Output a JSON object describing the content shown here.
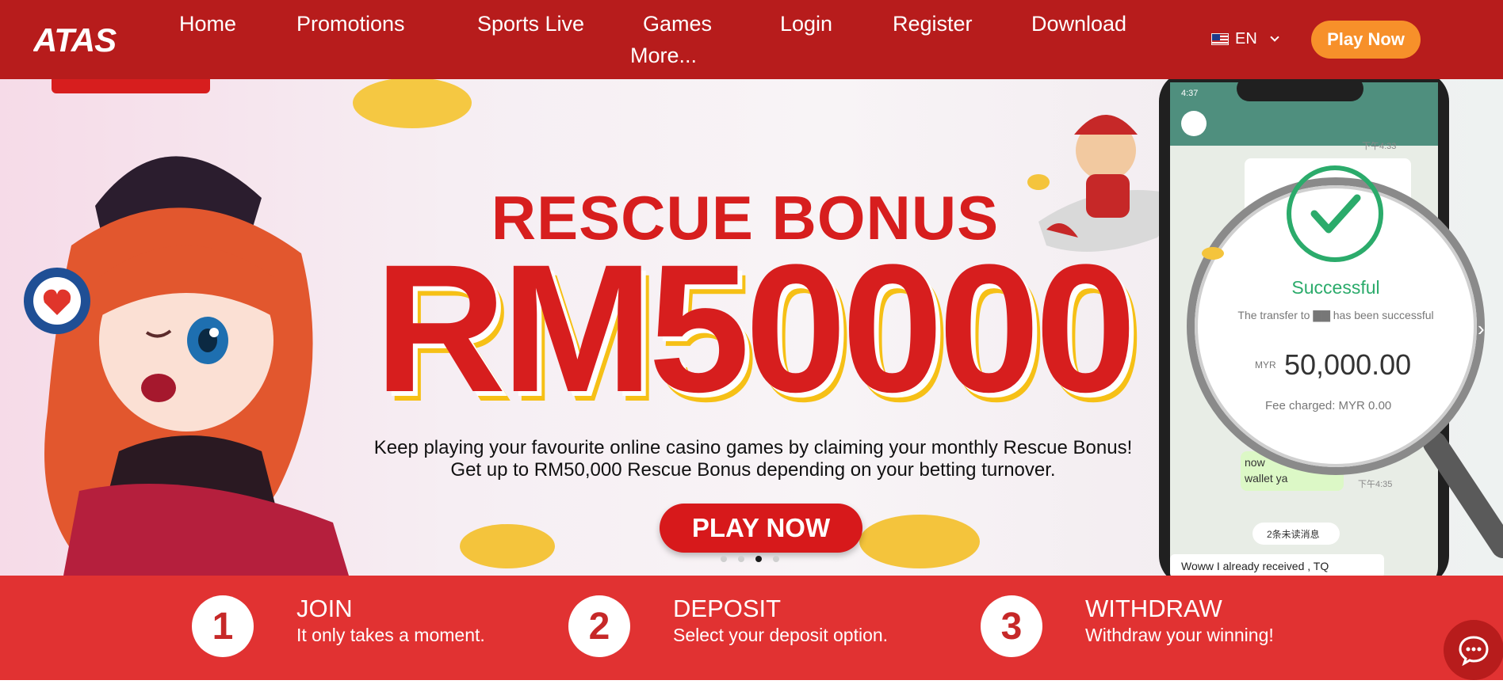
{
  "brand": {
    "logo_text": "ATAS"
  },
  "nav": {
    "items": [
      "Home",
      "Promotions",
      "Sports Live",
      "Games",
      "Login",
      "Register",
      "Download",
      "More..."
    ],
    "language": "EN",
    "play_now": "Play Now"
  },
  "hero": {
    "title": "RESCUE BONUS",
    "amount": "RM50000",
    "line1": "Keep playing your favourite online casino games by claiming your monthly Rescue Bonus!",
    "line2": "Get up to RM50,000 Rescue Bonus depending on your betting turnover.",
    "button": "PLAY NOW",
    "slide_count": 4,
    "active_slide": 3,
    "phone": {
      "time": "4:37",
      "status": "Successful",
      "message": "The transfer to ▇▇ has been successful",
      "currency": "MYR",
      "value": "50,000.00",
      "fee": "Fee charged:  MYR 0.00",
      "chat_snippet_1": "now",
      "chat_snippet_2": "wallet ya",
      "unread": "2条未读消息",
      "chat_bottom": "Woww I already received , TQ",
      "ts1": "下午4:33",
      "ts2": "下午4:35"
    }
  },
  "steps": [
    {
      "number": "1",
      "title": "JOIN",
      "desc": "It only takes a moment."
    },
    {
      "number": "2",
      "title": "DEPOSIT",
      "desc": "Select your deposit option."
    },
    {
      "number": "3",
      "title": "WITHDRAW",
      "desc": "Withdraw your winning!"
    }
  ],
  "colors": {
    "nav_bg": "#b71c1c",
    "accent": "#f7902a",
    "hero_red": "#d71e1e",
    "steps_bg": "#e13232",
    "success_green": "#2bab6b"
  }
}
